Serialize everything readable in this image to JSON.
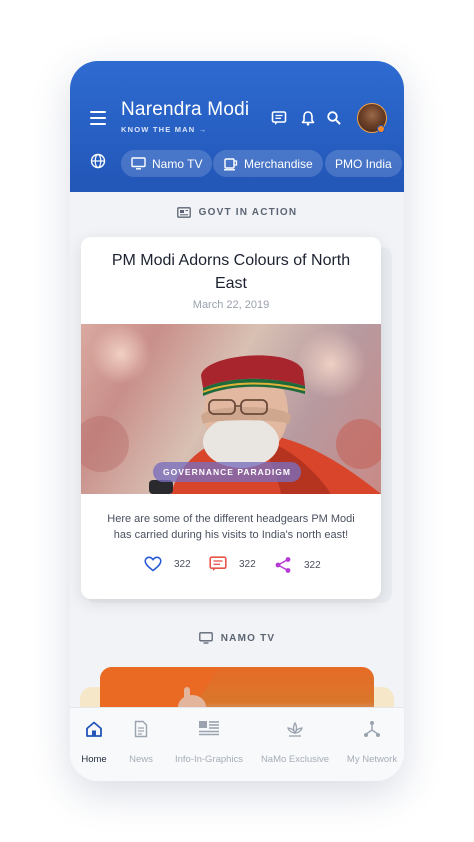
{
  "header": {
    "title": "Narendra Modi",
    "subtitle": "KNOW THE MAN →"
  },
  "chips": [
    {
      "label": "Namo TV",
      "icon": "tv-icon"
    },
    {
      "label": "Merchandise",
      "icon": "coffee-mug-icon"
    },
    {
      "label": "PMO India",
      "icon": ""
    }
  ],
  "section_govt": {
    "label": "GOVT IN ACTION",
    "icon": "newspaper-icon"
  },
  "article": {
    "title": "PM Modi Adorns Colours of North East",
    "date": "March 22, 2019",
    "tag": "GOVERNANCE PARADIGM",
    "description": "Here are some of the different headgears PM Modi has carried during his visits to India's north east!",
    "likes": "322",
    "comments": "322",
    "shares": "322"
  },
  "section_namo": {
    "label": "NAMO TV",
    "icon": "tv-icon"
  },
  "bottom_nav": [
    {
      "label": "Home",
      "icon": "home-icon",
      "active": true
    },
    {
      "label": "News",
      "icon": "document-icon",
      "active": false
    },
    {
      "label": "Info-In-Graphics",
      "icon": "infographic-icon",
      "active": false
    },
    {
      "label": "NaMo Exclusive",
      "icon": "lotus-icon",
      "active": false
    },
    {
      "label": "My Network",
      "icon": "network-icon",
      "active": false
    }
  ],
  "colors": {
    "header": "#2256b7",
    "like": "#2a5bd7",
    "comment": "#e8534b",
    "share": "#b53bd4",
    "accent": "#f58a2b"
  }
}
